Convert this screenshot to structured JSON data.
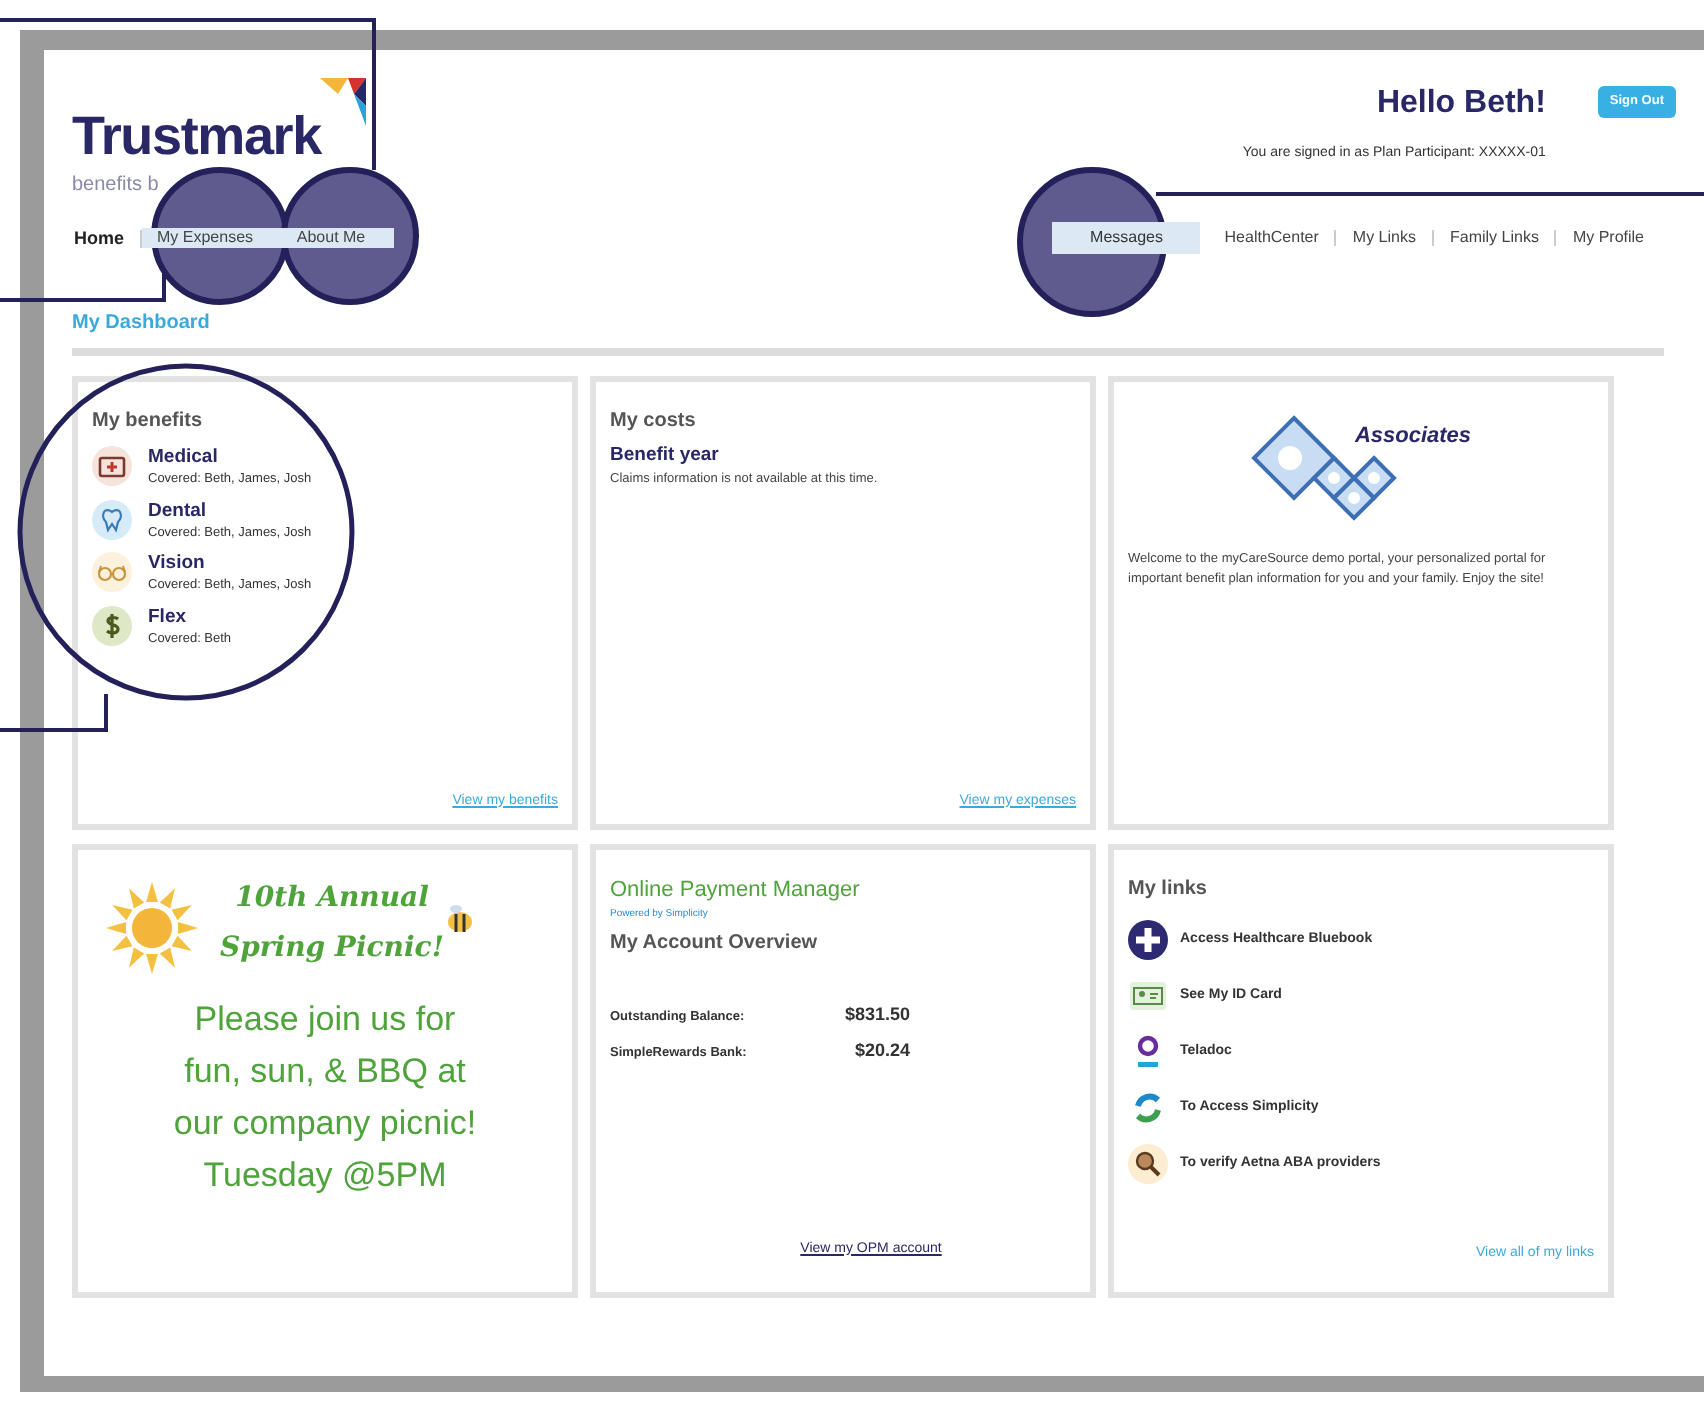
{
  "header": {
    "logo": "Trustmark",
    "tagline": "benefits b",
    "greeting": "Hello Beth!",
    "signed_in": "You are signed in as Plan Participant: XXXXX-01",
    "sign_out": "Sign Out"
  },
  "nav_left": [
    {
      "label": "Home",
      "highlighted": false
    },
    {
      "label": "My Expenses",
      "highlighted": true
    },
    {
      "label": "About Me",
      "highlighted": true
    }
  ],
  "nav_right": [
    {
      "label": "Messages",
      "highlighted": true
    },
    {
      "label": "HealthCenter",
      "highlighted": false
    },
    {
      "label": "My Links",
      "highlighted": false
    },
    {
      "label": "Family Links",
      "highlighted": false
    },
    {
      "label": "My Profile",
      "highlighted": false
    }
  ],
  "page_title": "My Dashboard",
  "benefits": {
    "title": "My benefits",
    "items": [
      {
        "kind": "medical",
        "name": "Medical",
        "covered": "Covered: Beth, James, Josh"
      },
      {
        "kind": "dental",
        "name": "Dental",
        "covered": "Covered: Beth, James, Josh"
      },
      {
        "kind": "vision",
        "name": "Vision",
        "covered": "Covered: Beth, James, Josh"
      },
      {
        "kind": "flex",
        "name": "Flex",
        "covered": "Covered: Beth"
      }
    ],
    "link": "View my benefits"
  },
  "costs": {
    "title": "My costs",
    "subtitle": "Benefit year",
    "message": "Claims information is not available at this time.",
    "link": "View my expenses"
  },
  "welcome": {
    "logo": "Associates",
    "text": "Welcome to the myCareSource demo portal, your personalized portal for important benefit plan information for you and your family. Enjoy the site!"
  },
  "flyer": {
    "title_1": "10th Annual",
    "title_2": "Spring Picnic!",
    "lines": [
      "Please join us for",
      "fun, sun, & BBQ at",
      "our company picnic!",
      "Tuesday @5PM"
    ]
  },
  "payment": {
    "brand": "Online Payment Manager",
    "powered": "Powered by Simplicity",
    "title": "My Account Overview",
    "rows": [
      {
        "label": "Outstanding Balance:",
        "value": "$831.50"
      },
      {
        "label": "SimpleRewards Bank:",
        "value": "$20.24"
      }
    ],
    "link": "View my OPM account"
  },
  "links": {
    "title": "My links",
    "items": [
      {
        "kind": "bluebook",
        "label": "Access Healthcare Bluebook"
      },
      {
        "kind": "idcard",
        "label": "See My ID Card"
      },
      {
        "kind": "teladoc",
        "label": "Teladoc"
      },
      {
        "kind": "simplicity",
        "label": "To Access Simplicity"
      },
      {
        "kind": "search",
        "label": "To verify Aetna ABA providers"
      }
    ],
    "link": "View all of my links"
  }
}
